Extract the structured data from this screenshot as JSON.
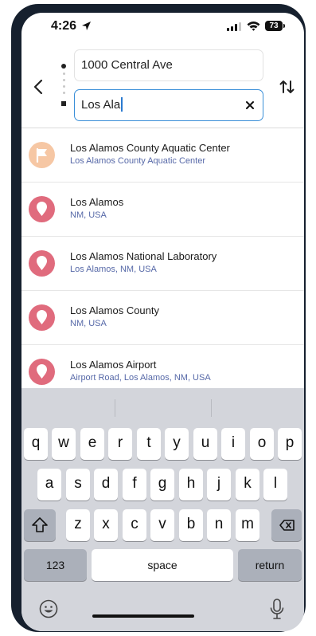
{
  "status_bar": {
    "time": "4:26",
    "battery": "73"
  },
  "route": {
    "origin": "1000 Central Ave",
    "destination": "Los Ala"
  },
  "results": [
    {
      "title": "Los Alamos County Aquatic Center",
      "subtitle": "Los Alamos County Aquatic Center",
      "icon": "flag-icon",
      "color": "#f6c7a4"
    },
    {
      "title": "Los Alamos",
      "subtitle": "NM, USA",
      "icon": "location-pin-icon",
      "color": "#e06b7d"
    },
    {
      "title": "Los Alamos National Laboratory",
      "subtitle": "Los Alamos, NM, USA",
      "icon": "location-pin-icon",
      "color": "#e06b7d"
    },
    {
      "title": "Los Alamos County",
      "subtitle": "NM, USA",
      "icon": "location-pin-icon",
      "color": "#e06b7d"
    },
    {
      "title": "Los Alamos Airport",
      "subtitle": "Airport Road, Los Alamos, NM, USA",
      "icon": "location-pin-icon",
      "color": "#e06b7d"
    }
  ],
  "keyboard": {
    "row1": [
      "q",
      "w",
      "e",
      "r",
      "t",
      "y",
      "u",
      "i",
      "o",
      "p"
    ],
    "row2": [
      "a",
      "s",
      "d",
      "f",
      "g",
      "h",
      "j",
      "k",
      "l"
    ],
    "row3": [
      "z",
      "x",
      "c",
      "v",
      "b",
      "n",
      "m"
    ],
    "numbers_label": "123",
    "space_label": "space",
    "return_label": "return"
  },
  "colors": {
    "accent": "#3a8fd8",
    "pin": "#e06b7d",
    "flag": "#f6c7a4",
    "subtitle": "#5769a8"
  }
}
